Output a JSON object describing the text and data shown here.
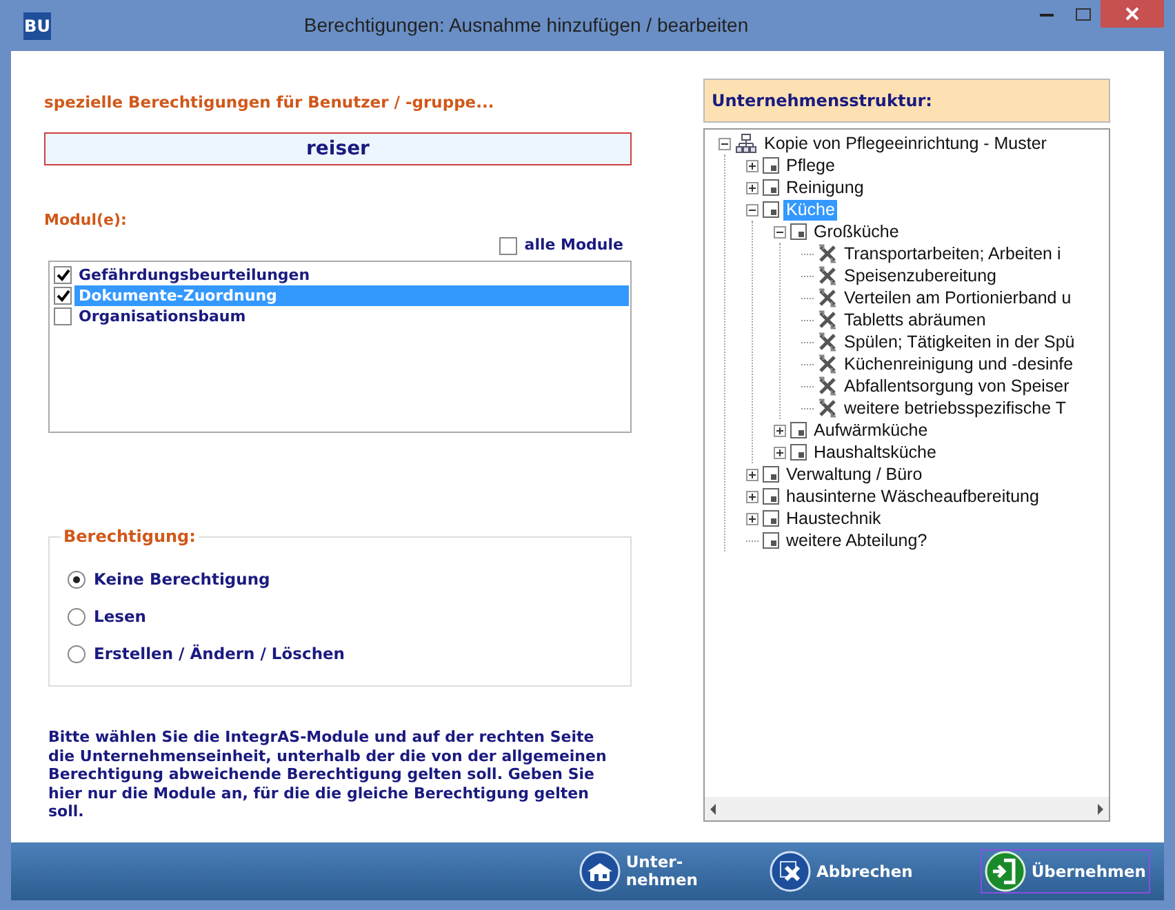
{
  "window": {
    "logo": "BU",
    "title": "Berechtigungen: Ausnahme hinzufügen / bearbeiten"
  },
  "left": {
    "heading": "spezielle Berechtigungen für Benutzer / -gruppe...",
    "user": "reiser",
    "modules_label": "Modul(e):",
    "all_modules": {
      "label": "alle Module",
      "checked": false
    },
    "modules": [
      {
        "label": "Gefährdungsbeurteilungen",
        "checked": true,
        "selected": false
      },
      {
        "label": "Dokumente-Zuordnung",
        "checked": true,
        "selected": true
      },
      {
        "label": "Organisationsbaum",
        "checked": false,
        "selected": false
      }
    ],
    "permission": {
      "legend": "Berechtigung:",
      "options": [
        {
          "label": "Keine Berechtigung",
          "selected": true
        },
        {
          "label": "Lesen",
          "selected": false
        },
        {
          "label": "Erstellen / Ändern / Löschen",
          "selected": false
        }
      ]
    },
    "hint": "Bitte wählen Sie die IntegrAS-Module und auf der rechten Seite die Unternehmenseinheit, unterhalb der die von der allgemeinen Berechtigung abweichende Berechtigung gelten soll. Geben Sie hier nur die Module an, für die die gleiche Berechtigung gelten soll."
  },
  "right": {
    "heading": "Unternehmensstruktur:",
    "tree": [
      {
        "label": "Kopie von Pflegeeinrichtung - Muster",
        "kind": "org",
        "expanded": true,
        "selected": false,
        "children": [
          {
            "label": "Pflege",
            "kind": "unit",
            "expanded": false,
            "selected": false
          },
          {
            "label": "Reinigung",
            "kind": "unit",
            "expanded": false,
            "selected": false
          },
          {
            "label": "Küche",
            "kind": "unit",
            "expanded": true,
            "selected": true,
            "children": [
              {
                "label": "Großküche",
                "kind": "unit",
                "expanded": true,
                "selected": false,
                "children": [
                  {
                    "label": "Transportarbeiten; Arbeiten i",
                    "kind": "task",
                    "selected": false
                  },
                  {
                    "label": "Speisenzubereitung",
                    "kind": "task",
                    "selected": false
                  },
                  {
                    "label": "Verteilen am Portionierband u",
                    "kind": "task",
                    "selected": false
                  },
                  {
                    "label": "Tabletts abräumen",
                    "kind": "task",
                    "selected": false
                  },
                  {
                    "label": "Spülen; Tätigkeiten in der Spü",
                    "kind": "task",
                    "selected": false
                  },
                  {
                    "label": "Küchenreinigung und -desinfe",
                    "kind": "task",
                    "selected": false
                  },
                  {
                    "label": "Abfallentsorgung von Speiser",
                    "kind": "task",
                    "selected": false
                  },
                  {
                    "label": "weitere betriebsspezifische T",
                    "kind": "task",
                    "selected": false
                  }
                ]
              },
              {
                "label": "Aufwärmküche",
                "kind": "unit",
                "expanded": false,
                "selected": false
              },
              {
                "label": "Haushaltsküche",
                "kind": "unit",
                "expanded": false,
                "selected": false
              }
            ]
          },
          {
            "label": "Verwaltung / Büro",
            "kind": "unit",
            "expanded": false,
            "selected": false
          },
          {
            "label": "hausinterne Wäscheaufbereitung",
            "kind": "unit",
            "expanded": false,
            "selected": false
          },
          {
            "label": "Haustechnik",
            "kind": "unit",
            "expanded": false,
            "selected": false
          },
          {
            "label": "weitere Abteilung?",
            "kind": "leaf",
            "selected": false
          }
        ]
      }
    ]
  },
  "buttons": [
    {
      "label": "Unter-\nnehmen",
      "kind": "company",
      "focused": false
    },
    {
      "label": "Abbrechen",
      "kind": "cancel",
      "focused": false
    },
    {
      "label": "Übernehmen",
      "kind": "apply",
      "focused": true
    }
  ]
}
